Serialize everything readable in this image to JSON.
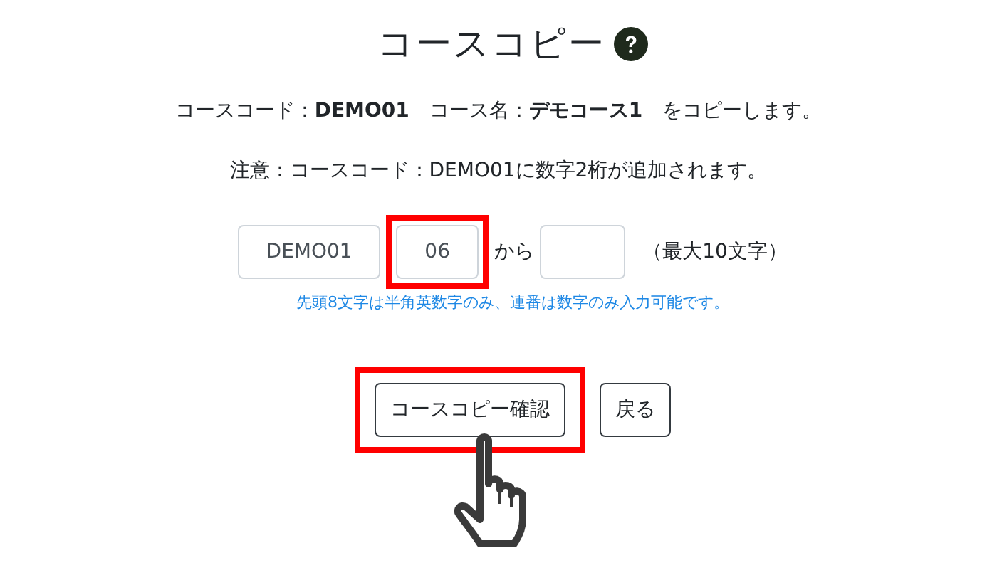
{
  "title": "コースコピー",
  "summary": "コースコード：**DEMO01**　コース名：**デモコース1**　をコピーします。",
  "notice": "注意：コースコード：DEMO01に数字2桁が追加されます。",
  "code_inputs": [
    {
      "value": "DEMO01",
      "highlighted": false
    },
    {
      "value": "06",
      "highlighted": true
    }
  ],
  "from_label": "から",
  "max_label": "（最大10文字）",
  "hint": "先頭8文字は半角英数字のみ、連番は数字のみ入力可能です。",
  "buttons": [
    {
      "label": "コースコピー確認",
      "highlighted": true,
      "pointer": true
    },
    {
      "label": "戻る",
      "highlighted": false,
      "pointer": false
    }
  ]
}
